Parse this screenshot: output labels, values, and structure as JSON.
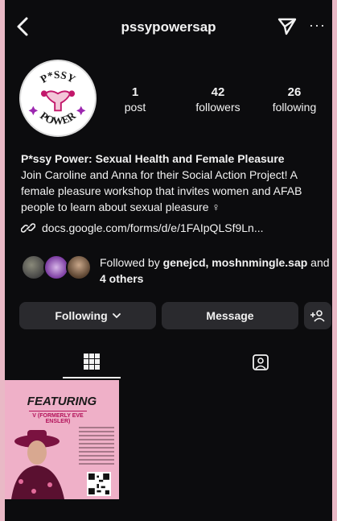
{
  "header": {
    "username": "pssypowersap",
    "more_label": "···"
  },
  "avatar": {
    "line1": "P*SSY",
    "line2": "POWER"
  },
  "stats": {
    "posts_count": "1",
    "posts_label": "post",
    "followers_count": "42",
    "followers_label": "followers",
    "following_count": "26",
    "following_label": "following"
  },
  "bio": {
    "name": "P*ssy Power: Sexual Health and Female Pleasure",
    "text": "Join Caroline and Anna for their Social Action Project! A female pleasure workshop that invites women and AFAB people to learn about sexual pleasure ♀",
    "link": "docs.google.com/forms/d/e/1FAIpQLSf9Ln..."
  },
  "followed_by": {
    "prefix": "Followed by ",
    "names": "genejcd, moshnmingle.sap",
    "and": " and ",
    "others": "4 others"
  },
  "buttons": {
    "following": "Following",
    "message": "Message"
  },
  "post": {
    "headline": "FEATURING",
    "sub": "V (FORMERLY EVE ENSLER)"
  },
  "colors": {
    "background": "#0c0c0e",
    "button": "#2a2a2e",
    "accent_pink": "#efb0c8"
  },
  "icons": {
    "back": "chevron-left-icon",
    "send": "paper-plane-icon",
    "more": "more-icon",
    "link": "link-icon",
    "add_user": "add-user-icon",
    "grid": "grid-icon",
    "tagged": "tagged-icon"
  }
}
